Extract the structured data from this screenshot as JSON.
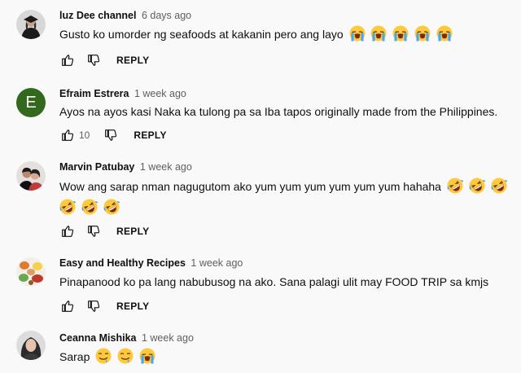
{
  "comments": [
    {
      "author": "luz Dee channel",
      "time": "6 days ago",
      "text": "Gusto ko umorder ng seafoods at kakanin pero ang layo",
      "emojis": [
        "loudly-crying-face",
        "loudly-crying-face",
        "loudly-crying-face",
        "loudly-crying-face",
        "loudly-crying-face"
      ],
      "likes": "",
      "reply_label": "REPLY",
      "avatar": "graduate-photo"
    },
    {
      "author": "Efraim Estrera",
      "time": "1 week ago",
      "text": "Ayos na ayos kasi Naka ka tulong pa sa Iba tapos originally made from the Philippines.",
      "likes": "10",
      "reply_label": "REPLY",
      "avatar": "E",
      "avatar_color": "#33691e"
    },
    {
      "author": "Marvin Patubay",
      "time": "1 week ago",
      "text": "Wow ang sarap nman nagugutom ako yum yum yum yum yum yum hahaha",
      "emojis_line1": [
        "rolling-laughing-face",
        "rolling-laughing-face",
        "rolling-laughing-face"
      ],
      "emojis_line2": [
        "rolling-laughing-face",
        "rolling-laughing-face",
        "rolling-laughing-face"
      ],
      "likes": "",
      "reply_label": "REPLY",
      "avatar": "couple-photo"
    },
    {
      "author": "Easy and Healthy Recipes",
      "time": "1 week ago",
      "text": "Pinapanood ko pa lang nabubusog na ako. Sana palagi ulit may FOOD TRIP sa kmjs",
      "likes": "",
      "reply_label": "REPLY",
      "avatar": "food-photo"
    },
    {
      "author": "Ceanna Mishika",
      "time": "1 week ago",
      "text": "Sarap",
      "emojis": [
        "drooling-face",
        "drooling-face",
        "loudly-crying-face"
      ],
      "avatar": "woman-photo"
    }
  ]
}
